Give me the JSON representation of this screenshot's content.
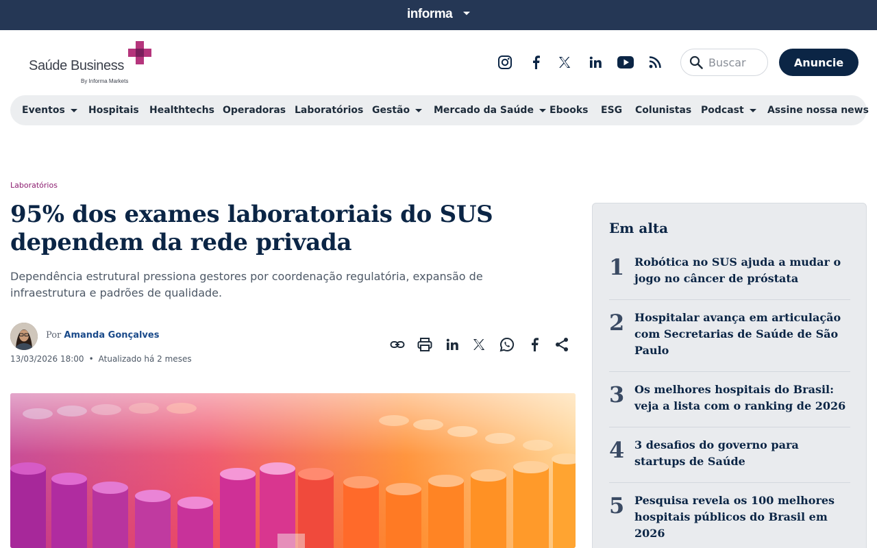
{
  "topbar": {
    "brand": "informa"
  },
  "header": {
    "logo": {
      "name": "Saúde Business",
      "tagline": "By Informa Markets"
    },
    "social": [
      "instagram-icon",
      "facebook-icon",
      "x-icon",
      "linkedin-icon",
      "youtube-icon",
      "rss-icon"
    ],
    "search_placeholder": "Buscar",
    "cta_label": "Anuncie"
  },
  "nav": {
    "items": [
      {
        "label": "Eventos",
        "dropdown": true
      },
      {
        "label": "Hospitais",
        "dropdown": false
      },
      {
        "label": "Healthtechs",
        "dropdown": false
      },
      {
        "label": "Operadoras",
        "dropdown": false
      },
      {
        "label": "Laboratórios",
        "dropdown": false
      },
      {
        "label": "Gestão",
        "dropdown": true
      },
      {
        "label": "Mercado da Saúde",
        "dropdown": true
      },
      {
        "label": "Ebooks",
        "dropdown": false
      },
      {
        "label": "ESG",
        "dropdown": false
      },
      {
        "label": "Colunistas",
        "dropdown": false
      },
      {
        "label": "Podcast",
        "dropdown": true
      },
      {
        "label": "Assine nossa news",
        "dropdown": false
      }
    ]
  },
  "article": {
    "category": "Laboratórios",
    "headline": "95% dos exames laboratoriais do SUS dependem da rede privada",
    "dek": "Dependência estrutural pressiona gestores por coordenação regulatória, expansão de infraestrutura e padrões de qualidade.",
    "by_prefix": "Por",
    "author": "Amanda Gonçalves",
    "date": "13/03/2026 18:00",
    "updated": "Atualizado há 2 meses",
    "share_icons": [
      "link-icon",
      "print-icon",
      "linkedin-icon",
      "x-icon",
      "whatsapp-icon",
      "facebook-icon",
      "share-icon"
    ]
  },
  "sidebar": {
    "title": "Em alta",
    "items": [
      {
        "rank": "1",
        "title": "Robótica no SUS ajuda a mudar o jogo no câncer de próstata"
      },
      {
        "rank": "2",
        "title": "Hospitalar avança em articulação com Secretarias de Saúde de São Paulo"
      },
      {
        "rank": "3",
        "title": "Os melhores hospitais do Brasil: veja a lista com o ranking de 2026"
      },
      {
        "rank": "4",
        "title": "3 desafios do governo para startups de Saúde"
      },
      {
        "rank": "5",
        "title": "Pesquisa revela os 100 melhores hospitais públicos do Brasil em 2026"
      }
    ]
  },
  "colors": {
    "topbar": "#253755",
    "navy": "#0b2545",
    "accent": "#8b1b6e",
    "nav_bg": "#eceef0",
    "sidebar_bg": "#e9ebee"
  }
}
